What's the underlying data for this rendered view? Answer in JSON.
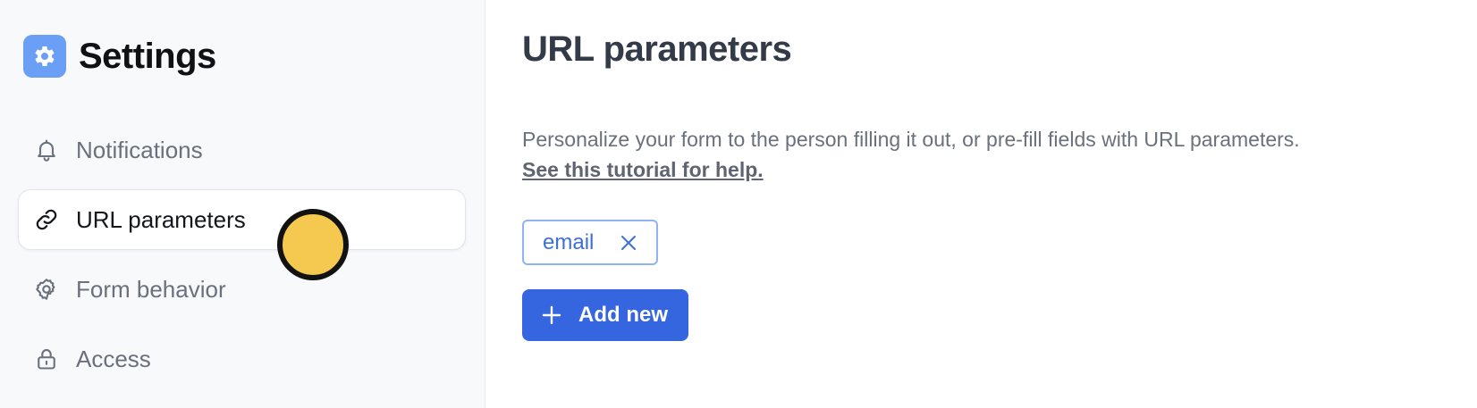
{
  "sidebar": {
    "title": "Settings",
    "app_icon": "gear-icon",
    "items": [
      {
        "label": "Notifications",
        "icon": "bell-icon",
        "active": false
      },
      {
        "label": "URL parameters",
        "icon": "link-icon",
        "active": true
      },
      {
        "label": "Form behavior",
        "icon": "gear-icon",
        "active": false
      },
      {
        "label": "Access",
        "icon": "lock-icon",
        "active": false
      }
    ]
  },
  "main": {
    "title": "URL parameters",
    "description": "Personalize your form to the person filling it out, or pre-fill fields with URL parameters.",
    "help_link": "See this tutorial for help.",
    "parameters": [
      {
        "label": "email"
      }
    ],
    "add_button_label": "Add new"
  },
  "colors": {
    "accent": "#3566e0",
    "tag_text": "#3c6fdb",
    "tag_border": "#8fb3f5",
    "app_icon_bg": "#6b9ef5",
    "sidebar_bg": "#f8f9fb",
    "cursor_marker": "#f5c94f"
  }
}
